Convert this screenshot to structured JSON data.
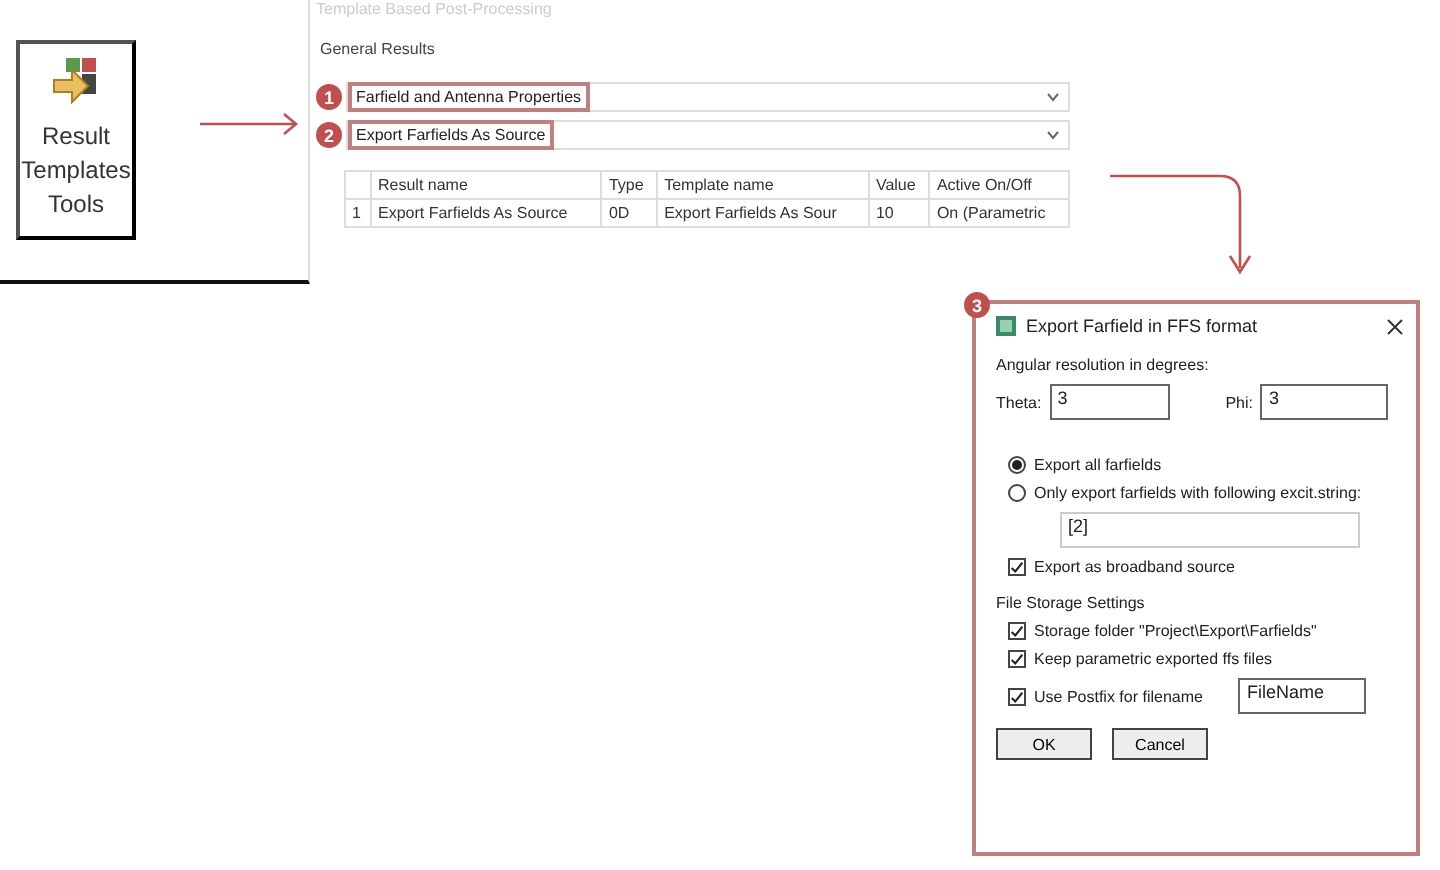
{
  "tool_button": {
    "label": "Result Templates Tools"
  },
  "panel": {
    "title": "Template Based Post-Processing",
    "section": "General Results",
    "steps": [
      {
        "badge": "1",
        "value": "Farfield and Antenna Properties"
      },
      {
        "badge": "2",
        "value": "Export Farfields As Source"
      }
    ],
    "table": {
      "columns": [
        "Result name",
        "Type",
        "Template name",
        "Value",
        "Active On/Off"
      ],
      "rows": [
        {
          "index": "1",
          "cells": [
            "Export Farfields As Source",
            "0D",
            "Export Farfields As Sour",
            "10",
            "On (Parametric"
          ]
        }
      ]
    }
  },
  "dialog": {
    "badge": "3",
    "title": "Export Farfield in FFS format",
    "angular_label": "Angular resolution in degrees:",
    "theta": {
      "label": "Theta:",
      "value": "3"
    },
    "phi": {
      "label": "Phi:",
      "value": "3"
    },
    "radios": [
      {
        "label": "Export all farfields",
        "selected": true
      },
      {
        "label": "Only export farfields with following excit.string:",
        "selected": false
      }
    ],
    "excitation_value": "[2]",
    "broadband": {
      "label": "Export as broadband source",
      "checked": true
    },
    "storage_heading": "File Storage Settings",
    "storage_options": [
      {
        "label": "Storage folder \"Project\\Export\\Farfields\"",
        "checked": true
      },
      {
        "label": "Keep parametric exported ffs files",
        "checked": true
      },
      {
        "label": "Use Postfix for filename",
        "checked": true,
        "field": "FileName"
      }
    ],
    "buttons": [
      "OK",
      "Cancel"
    ]
  }
}
